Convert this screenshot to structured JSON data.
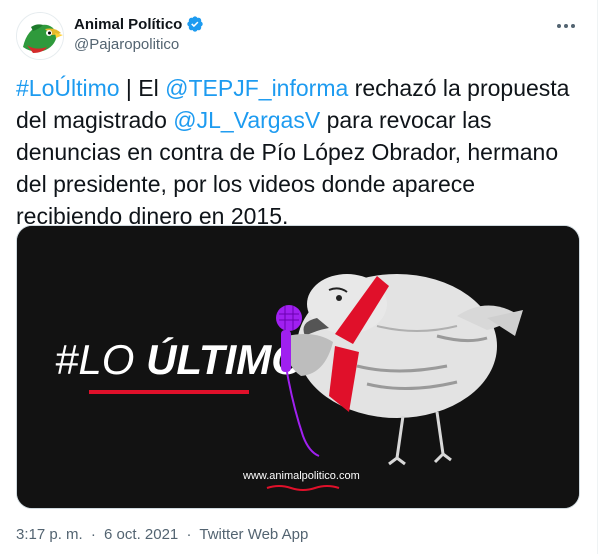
{
  "author": {
    "display_name": "Animal Político",
    "handle": "@Pajaropolitico",
    "avatar_icon": "bird-avatar-icon",
    "verified_icon": "verified-badge-icon"
  },
  "tweet": {
    "parts": [
      {
        "text": "#LoÚltimo",
        "link": true
      },
      {
        "text": " | El ",
        "link": false
      },
      {
        "text": "@TEPJF_informa",
        "link": true
      },
      {
        "text": " rechazó la propuesta del magistrado ",
        "link": false
      },
      {
        "text": "@JL_VargasV",
        "link": true
      },
      {
        "text": " para revocar las denuncias en contra de Pío López Obrador, hermano del presidente, por los videos donde aparece recibiendo dinero en 2015.",
        "link": false
      }
    ]
  },
  "media": {
    "headline_prefix": "#LO ",
    "headline_bold": "ÚLTIMO",
    "site": "www.animalpolitico.com"
  },
  "meta": {
    "time": "3:17 p. m.",
    "sep1": "·",
    "date": "6 oct. 2021",
    "sep2": "·",
    "client": "Twitter Web App"
  },
  "colors": {
    "link": "#1d9bf0",
    "accent_red": "#e0102a",
    "mic_purple": "#a020f0",
    "bg_dark": "#121212"
  }
}
